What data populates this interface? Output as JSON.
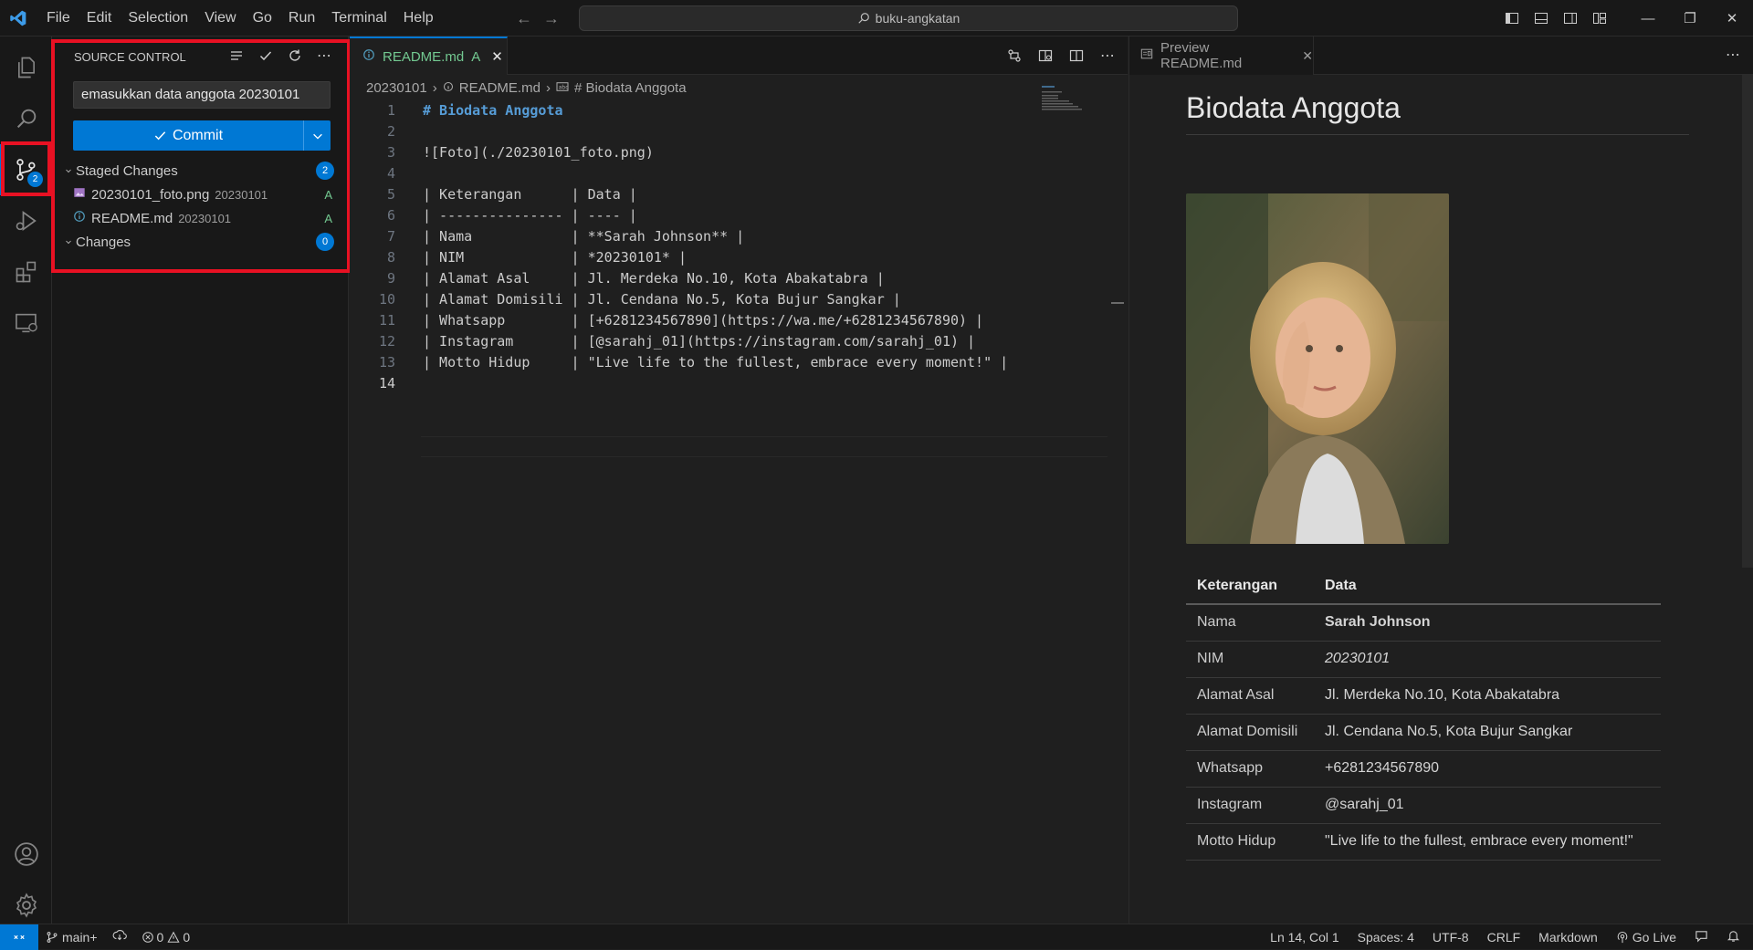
{
  "titlebar": {
    "menu": [
      "File",
      "Edit",
      "Selection",
      "View",
      "Go",
      "Run",
      "Terminal",
      "Help"
    ],
    "search_text": "buku-angkatan",
    "window_controls": [
      "minimize",
      "restore",
      "close"
    ]
  },
  "activitybar": {
    "items": [
      "explorer",
      "search",
      "source-control",
      "run-and-debug",
      "extensions",
      "remote-explorer"
    ],
    "source_control_badge": "2",
    "bottom": [
      "accounts",
      "manage"
    ]
  },
  "sidebar": {
    "title": "SOURCE CONTROL",
    "commit_message": "emasukkan data anggota 20230101",
    "commit_label": "Commit",
    "staged": {
      "label": "Staged Changes",
      "count": "2",
      "files": [
        {
          "name": "20230101_foto.png",
          "dir": "20230101",
          "status": "A"
        },
        {
          "name": "README.md",
          "dir": "20230101",
          "status": "A"
        }
      ]
    },
    "changes": {
      "label": "Changes",
      "count": "0"
    }
  },
  "editor": {
    "tab": {
      "name": "README.md",
      "status": "A"
    },
    "breadcrumbs": [
      "20230101",
      "README.md",
      "# Biodata Anggota"
    ],
    "lines": [
      "# Biodata Anggota",
      "",
      "![Foto](./20230101_foto.png)",
      "",
      "| Keterangan      | Data |",
      "| --------------- | ---- |",
      "| Nama            | **Sarah Johnson** |",
      "| NIM             | *20230101* |",
      "| Alamat Asal     | Jl. Merdeka No.10, Kota Abakatabra |",
      "| Alamat Domisili | Jl. Cendana No.5, Kota Bujur Sangkar |",
      "| Whatsapp        | [+6281234567890](https://wa.me/+6281234567890) |",
      "| Instagram       | [@sarahj_01](https://instagram.com/sarahj_01) |",
      "| Motto Hidup     | \"Live life to the fullest, embrace every moment!\" |",
      ""
    ],
    "line_numbers": [
      "1",
      "2",
      "3",
      "4",
      "5",
      "6",
      "7",
      "8",
      "9",
      "10",
      "11",
      "12",
      "13",
      "14"
    ]
  },
  "preview": {
    "tab": "Preview README.md",
    "heading": "Biodata Anggota",
    "table_header": [
      "Keterangan",
      "Data"
    ],
    "rows": [
      {
        "label": "Nama",
        "value": "Sarah Johnson"
      },
      {
        "label": "NIM",
        "value": "20230101"
      },
      {
        "label": "Alamat Asal",
        "value": "Jl. Merdeka No.10, Kota Abakatabra"
      },
      {
        "label": "Alamat Domisili",
        "value": "Jl. Cendana No.5, Kota Bujur Sangkar"
      },
      {
        "label": "Whatsapp",
        "value": "+6281234567890"
      },
      {
        "label": "Instagram",
        "value": "@sarahj_01"
      },
      {
        "label": "Motto Hidup",
        "value": "\"Live life to the fullest, embrace every moment!\""
      }
    ]
  },
  "statusbar": {
    "branch": "main+",
    "errors": "0",
    "warnings": "0",
    "position": "Ln 14, Col 1",
    "spaces": "Spaces: 4",
    "encoding": "UTF-8",
    "eol": "CRLF",
    "language": "Markdown",
    "golive": "Go Live"
  },
  "colors": {
    "accent": "#0078d4",
    "added": "#73c991",
    "highlight": "#e81123",
    "link": "#3794ff"
  }
}
